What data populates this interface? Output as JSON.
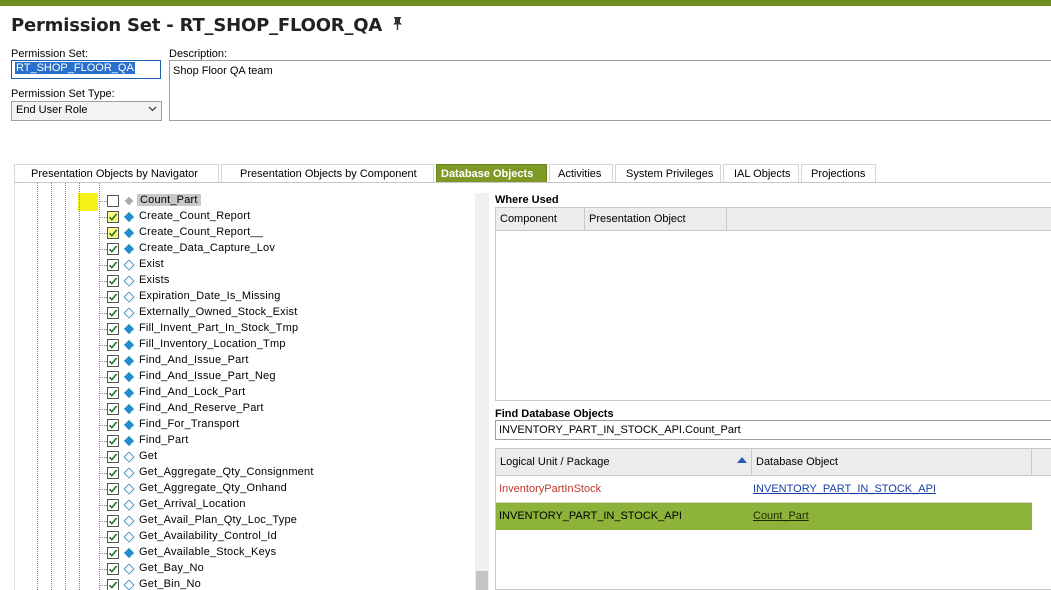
{
  "window": {
    "title": "Permission Set - RT_SHOP_FLOOR_QA",
    "pin_icon": "pin-icon"
  },
  "form": {
    "permission_set_label": "Permission Set:",
    "permission_set_value": "RT_SHOP_FLOOR_QA",
    "description_label": "Description:",
    "description_value": "Shop Floor QA  team",
    "type_label": "Permission Set Type:",
    "type_value": "End User Role"
  },
  "tabs": [
    {
      "label": "Presentation Objects by Navigator",
      "active": false
    },
    {
      "label": "Presentation Objects by Component",
      "active": false
    },
    {
      "label": "Database Objects",
      "active": true
    },
    {
      "label": "Activities",
      "active": false
    },
    {
      "label": "System Privileges",
      "active": false
    },
    {
      "label": "IAL Objects",
      "active": false
    },
    {
      "label": "Projections",
      "active": false
    }
  ],
  "tree": {
    "items": [
      {
        "label": "Count_Part",
        "checked": false,
        "icon": "grey-diamond-icon",
        "selected": true
      },
      {
        "label": "Create_Count_Report",
        "checked": true,
        "icon": "filled-diamond-icon"
      },
      {
        "label": "Create_Count_Report__",
        "checked": true,
        "icon": "filled-diamond-icon"
      },
      {
        "label": "Create_Data_Capture_Lov",
        "checked": true,
        "icon": "filled-diamond-icon"
      },
      {
        "label": "Exist",
        "checked": true,
        "icon": "outline-diamond-icon"
      },
      {
        "label": "Exists",
        "checked": true,
        "icon": "outline-diamond-icon"
      },
      {
        "label": "Expiration_Date_Is_Missing",
        "checked": true,
        "icon": "outline-diamond-icon"
      },
      {
        "label": "Externally_Owned_Stock_Exist",
        "checked": true,
        "icon": "outline-diamond-icon"
      },
      {
        "label": "Fill_Invent_Part_In_Stock_Tmp",
        "checked": true,
        "icon": "filled-diamond-icon"
      },
      {
        "label": "Fill_Inventory_Location_Tmp",
        "checked": true,
        "icon": "filled-diamond-icon"
      },
      {
        "label": "Find_And_Issue_Part",
        "checked": true,
        "icon": "filled-diamond-icon"
      },
      {
        "label": "Find_And_Issue_Part_Neg",
        "checked": true,
        "icon": "filled-diamond-icon"
      },
      {
        "label": "Find_And_Lock_Part",
        "checked": true,
        "icon": "filled-diamond-icon"
      },
      {
        "label": "Find_And_Reserve_Part",
        "checked": true,
        "icon": "filled-diamond-icon"
      },
      {
        "label": "Find_For_Transport",
        "checked": true,
        "icon": "filled-diamond-icon"
      },
      {
        "label": "Find_Part",
        "checked": true,
        "icon": "filled-diamond-icon"
      },
      {
        "label": "Get",
        "checked": true,
        "icon": "outline-diamond-icon"
      },
      {
        "label": "Get_Aggregate_Qty_Consignment",
        "checked": true,
        "icon": "outline-diamond-icon"
      },
      {
        "label": "Get_Aggregate_Qty_Onhand",
        "checked": true,
        "icon": "outline-diamond-icon"
      },
      {
        "label": "Get_Arrival_Location",
        "checked": true,
        "icon": "outline-diamond-icon"
      },
      {
        "label": "Get_Avail_Plan_Qty_Loc_Type",
        "checked": true,
        "icon": "outline-diamond-icon"
      },
      {
        "label": "Get_Availability_Control_Id",
        "checked": true,
        "icon": "outline-diamond-icon"
      },
      {
        "label": "Get_Available_Stock_Keys",
        "checked": true,
        "icon": "filled-diamond-icon"
      },
      {
        "label": "Get_Bay_No",
        "checked": true,
        "icon": "outline-diamond-icon"
      },
      {
        "label": "Get_Bin_No",
        "checked": true,
        "icon": "outline-diamond-icon"
      }
    ]
  },
  "where_used": {
    "title": "Where Used",
    "columns": [
      "Component",
      "Presentation Object"
    ]
  },
  "find": {
    "title": "Find Database Objects",
    "value": "INVENTORY_PART_IN_STOCK_API.Count_Part",
    "columns": [
      "Logical Unit / Package",
      "Database Object"
    ],
    "rows": [
      {
        "lu": "InventoryPartInStock",
        "object": "INVENTORY_PART_IN_STOCK_API",
        "selected": false
      },
      {
        "lu": "INVENTORY_PART_IN_STOCK_API",
        "object": "Count_Part",
        "selected": true
      }
    ]
  },
  "colors": {
    "accent": "#7e9a26",
    "topbar": "#6f8f1f",
    "selected_row": "#8db33a",
    "icon_blue": "#1f8ec9",
    "highlight_yellow": "#f7f21a"
  }
}
